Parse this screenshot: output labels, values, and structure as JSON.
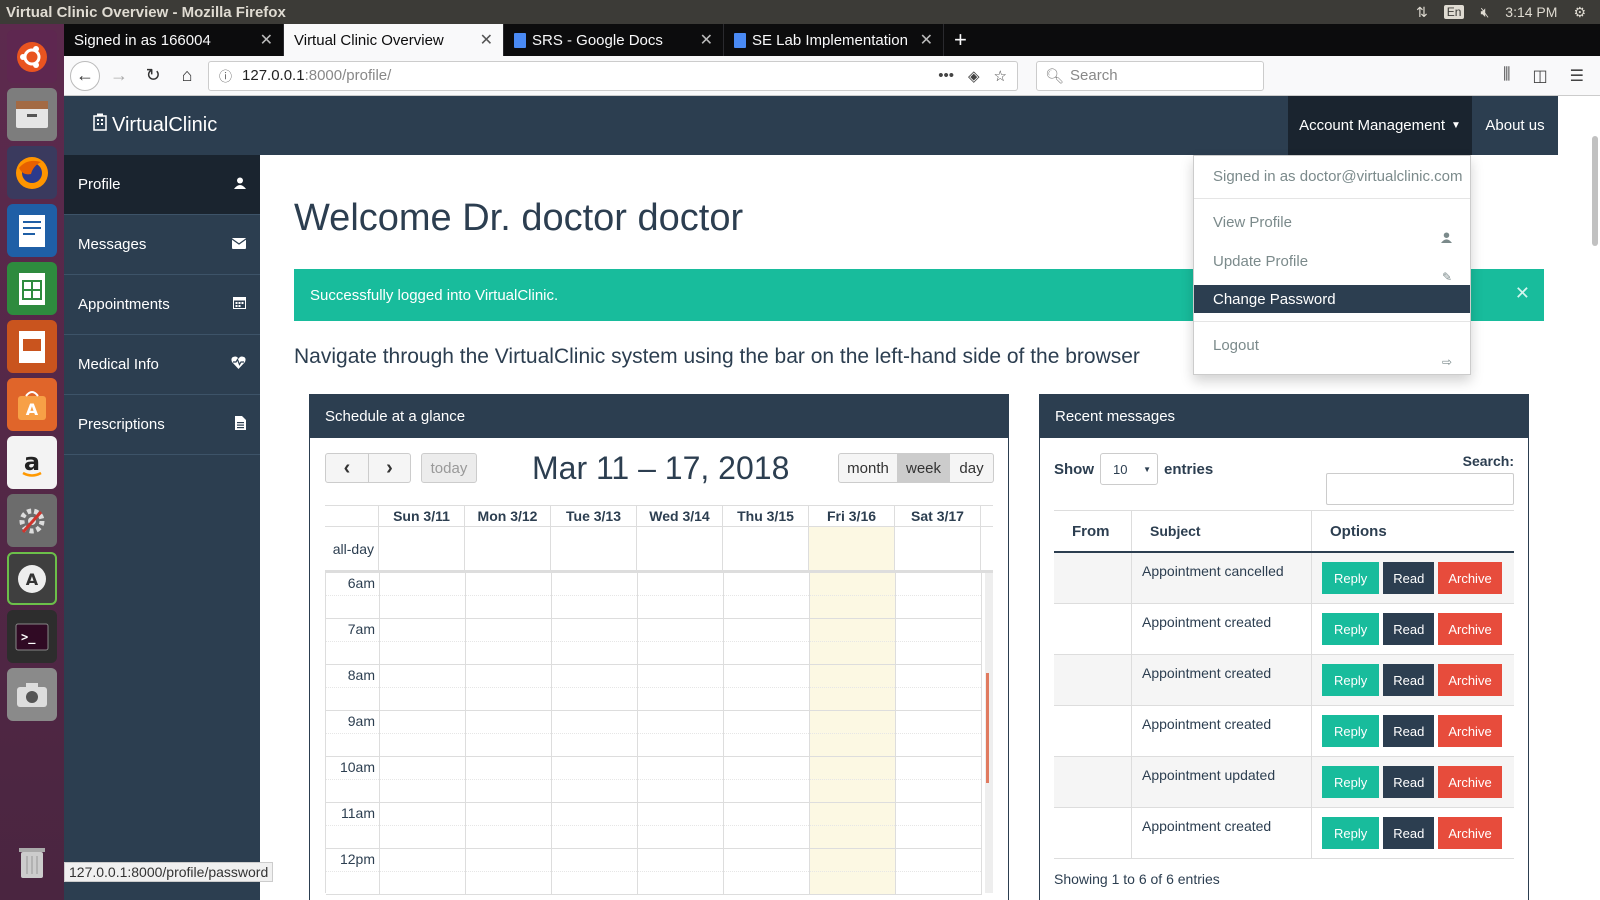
{
  "os": {
    "window_title": "Virtual Clinic Overview - Mozilla Firefox",
    "lang": "En",
    "time": "3:14 PM"
  },
  "browser": {
    "tabs": [
      {
        "label": "Signed in as 166004"
      },
      {
        "label": "Virtual Clinic Overview"
      },
      {
        "label": "SRS - Google Docs"
      },
      {
        "label": "SE Lab Implementation"
      }
    ],
    "url_host": "127.0.0.1",
    "url_rest": ":8000/profile/",
    "search_placeholder": "Search",
    "status_link": "127.0.0.1:8000/profile/password"
  },
  "app": {
    "brand": "VirtualClinic",
    "nav_account": "Account Management",
    "nav_about": "About us",
    "sidebar": [
      {
        "label": "Profile",
        "icon": "user-icon"
      },
      {
        "label": "Messages",
        "icon": "envelope-icon"
      },
      {
        "label": "Appointments",
        "icon": "calendar-icon"
      },
      {
        "label": "Medical Info",
        "icon": "heartbeat-icon"
      },
      {
        "label": "Prescriptions",
        "icon": "file-icon"
      }
    ],
    "welcome": "Welcome Dr. doctor doctor",
    "alert": "Successfully logged into VirtualClinic.",
    "nav_hint": "Navigate through the VirtualClinic system using the bar on the left-hand side of the browser"
  },
  "dropdown": {
    "signed_in": "Signed in as doctor@virtualclinic.com",
    "view_profile": "View Profile",
    "update_profile": "Update Profile",
    "change_password": "Change Password",
    "logout": "Logout"
  },
  "schedule": {
    "title": "Schedule at a glance",
    "today": "today",
    "range": "Mar 11 – 17, 2018",
    "views": [
      "month",
      "week",
      "day"
    ],
    "active_view": "week",
    "all_day": "all-day",
    "days": [
      "Sun 3/11",
      "Mon 3/12",
      "Tue 3/13",
      "Wed 3/14",
      "Thu 3/15",
      "Fri 3/16",
      "Sat 3/17"
    ],
    "today_day": "Fri 3/16",
    "hours": [
      "6am",
      "7am",
      "8am",
      "9am",
      "10am",
      "11am",
      "12pm"
    ],
    "today_color": "#fcf8e3"
  },
  "messages": {
    "title": "Recent messages",
    "show": "Show",
    "entries_value": "10",
    "entries": "entries",
    "search": "Search:",
    "columns": [
      "From",
      "Subject",
      "Options"
    ],
    "rows": [
      {
        "from": "",
        "subject": "Appointment cancelled"
      },
      {
        "from": "",
        "subject": "Appointment created"
      },
      {
        "from": "",
        "subject": "Appointment created"
      },
      {
        "from": "",
        "subject": "Appointment created"
      },
      {
        "from": "",
        "subject": "Appointment updated"
      },
      {
        "from": "",
        "subject": "Appointment created"
      }
    ],
    "btn_reply": "Reply",
    "btn_read": "Read",
    "btn_archive": "Archive",
    "footer": "Showing 1 to 6 of 6 entries"
  },
  "colors": {
    "primary": "#2c3e50",
    "success": "#18bc9c",
    "danger": "#e74c3c"
  }
}
